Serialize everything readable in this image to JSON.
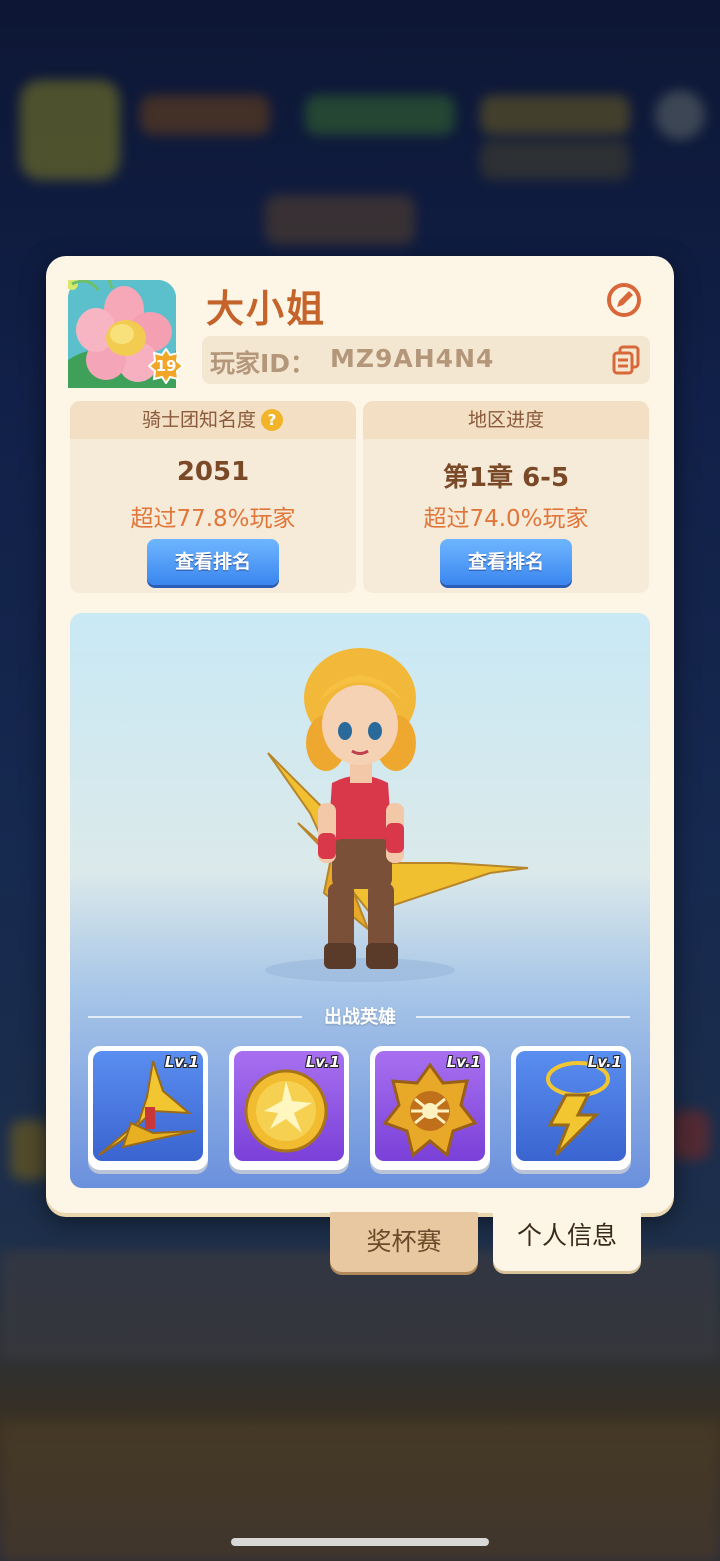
{
  "player": {
    "name": "大小姐",
    "id_label": "玩家ID：",
    "id_value": "MZ9AH4N4",
    "level": "19"
  },
  "stats": [
    {
      "title": "骑士团知名度",
      "value": "2051",
      "subtitle": "超过77.8%玩家",
      "button": "查看排名",
      "has_help_icon": true
    },
    {
      "title": "地区进度",
      "value": "第1章 6-5",
      "subtitle": "超过74.0%玩家",
      "button": "查看排名",
      "has_help_icon": false
    }
  ],
  "heroes_section": {
    "heading": "出战英雄",
    "items": [
      {
        "level": "Lv.1",
        "icon": "lightning-bow-icon",
        "color": "blue"
      },
      {
        "level": "Lv.1",
        "icon": "lightning-orb-icon",
        "color": "purple"
      },
      {
        "level": "Lv.1",
        "icon": "spider-badge-icon",
        "color": "purple"
      },
      {
        "level": "Lv.1",
        "icon": "lightning-amulet-icon",
        "color": "blue"
      }
    ]
  },
  "tabs": {
    "trophy": "奖杯赛",
    "info": "个人信息",
    "active": "info"
  },
  "colors": {
    "name": "#c4632a",
    "highlight": "#e0763a",
    "button": "#3a86ef",
    "card": "#fdf6e7"
  }
}
